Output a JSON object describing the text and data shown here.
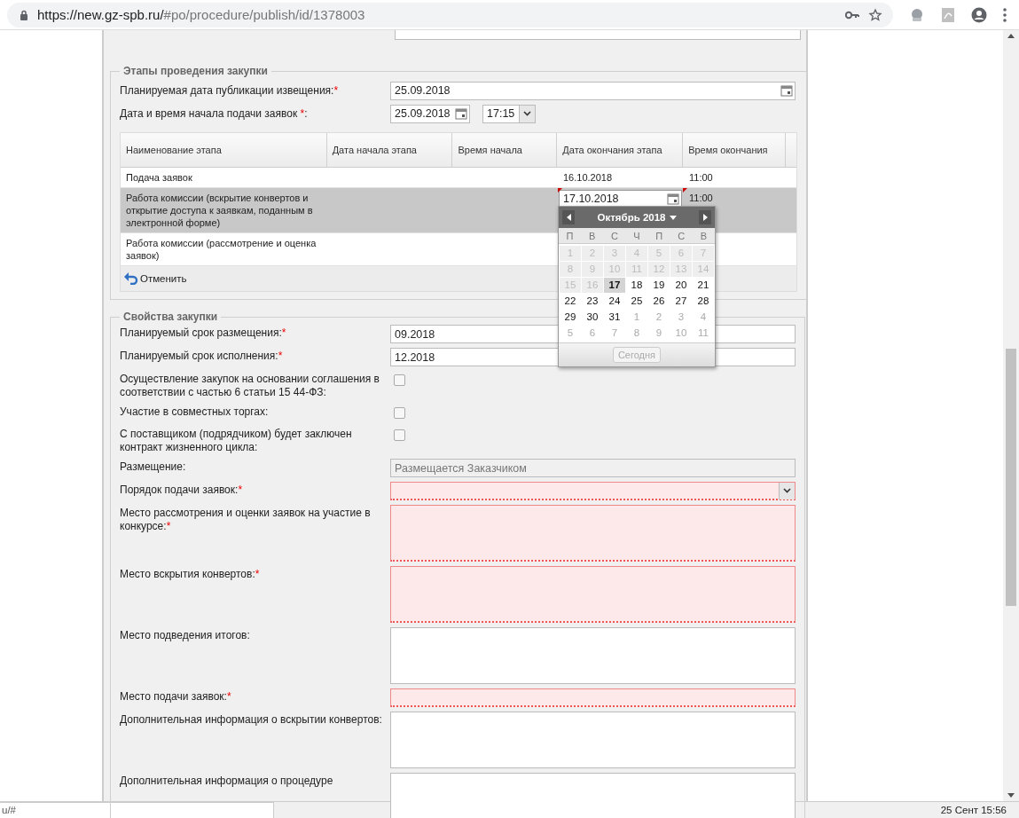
{
  "browser": {
    "url_host": "https://new.gz-spb.ru/",
    "url_path": "#po/procedure/publish/id/1378003"
  },
  "stages": {
    "title": "Этапы проведения закупки",
    "fields": [
      {
        "kind": "date",
        "label": "Планируемая дата публикации извещения:",
        "mark": "*",
        "value": "25.09.2018"
      },
      {
        "kind": "datetime",
        "label": "Дата и время начала подачи заявок ",
        "mark": "*",
        "suffix": ":",
        "value": "25.09.2018",
        "time": "17:15"
      }
    ],
    "columns": [
      {
        "label": "Наименование этапа"
      },
      {
        "label": "Дата начала этапа"
      },
      {
        "label": "Время начала"
      },
      {
        "label": "Дата окончания этапа"
      },
      {
        "label": "Время окончания"
      }
    ],
    "rows": [
      {
        "name": "Подача заявок",
        "end_date": "16.10.2018",
        "end_time": "11:00",
        "selected": false,
        "editing": false
      },
      {
        "name": "Работа комиссии (вскрытие конвертов и открытие доступа к заявкам, поданным в электронной форме)",
        "end_date": "17.10.2018",
        "end_time": "11:00",
        "selected": true,
        "editing": true
      },
      {
        "name": "Работа комиссии (рассмотрение и оценка заявок)",
        "selected": false,
        "editing": false
      }
    ],
    "cancel": "Отменить",
    "calendar": {
      "month": "Октябрь 2018",
      "weekdays": [
        "П",
        "В",
        "С",
        "Ч",
        "П",
        "С",
        "В"
      ],
      "today": "Сегодня",
      "days": [
        {
          "d": "1",
          "kind": "disabled",
          "selected": false
        },
        {
          "d": "2",
          "kind": "disabled",
          "selected": false
        },
        {
          "d": "3",
          "kind": "disabled",
          "selected": false
        },
        {
          "d": "4",
          "kind": "disabled",
          "selected": false
        },
        {
          "d": "5",
          "kind": "disabled",
          "selected": false
        },
        {
          "d": "6",
          "kind": "disabled",
          "selected": false
        },
        {
          "d": "7",
          "kind": "disabled",
          "selected": false
        },
        {
          "d": "8",
          "kind": "disabled",
          "selected": false
        },
        {
          "d": "9",
          "kind": "disabled",
          "selected": false
        },
        {
          "d": "10",
          "kind": "disabled",
          "selected": false
        },
        {
          "d": "11",
          "kind": "disabled",
          "selected": false
        },
        {
          "d": "12",
          "kind": "disabled",
          "selected": false
        },
        {
          "d": "13",
          "kind": "disabled",
          "selected": false
        },
        {
          "d": "14",
          "kind": "disabled",
          "selected": false
        },
        {
          "d": "15",
          "kind": "disabled",
          "selected": false
        },
        {
          "d": "16",
          "kind": "disabled",
          "selected": false
        },
        {
          "d": "17",
          "kind": "current",
          "selected": true
        },
        {
          "d": "18",
          "kind": "current",
          "selected": false
        },
        {
          "d": "19",
          "kind": "current",
          "selected": false
        },
        {
          "d": "20",
          "kind": "current",
          "selected": false
        },
        {
          "d": "21",
          "kind": "current",
          "selected": false
        },
        {
          "d": "22",
          "kind": "current",
          "selected": false
        },
        {
          "d": "23",
          "kind": "current",
          "selected": false
        },
        {
          "d": "24",
          "kind": "current",
          "selected": false
        },
        {
          "d": "25",
          "kind": "current",
          "selected": false
        },
        {
          "d": "26",
          "kind": "current",
          "selected": false
        },
        {
          "d": "27",
          "kind": "current",
          "selected": false
        },
        {
          "d": "28",
          "kind": "current",
          "selected": false
        },
        {
          "d": "29",
          "kind": "current",
          "selected": false
        },
        {
          "d": "30",
          "kind": "current",
          "selected": false
        },
        {
          "d": "31",
          "kind": "current",
          "selected": false
        },
        {
          "d": "1",
          "kind": "other",
          "selected": false
        },
        {
          "d": "2",
          "kind": "other",
          "selected": false
        },
        {
          "d": "3",
          "kind": "other",
          "selected": false
        },
        {
          "d": "4",
          "kind": "other",
          "selected": false
        },
        {
          "d": "5",
          "kind": "other",
          "selected": false
        },
        {
          "d": "6",
          "kind": "other",
          "selected": false
        },
        {
          "d": "7",
          "kind": "other",
          "selected": false
        },
        {
          "d": "8",
          "kind": "other",
          "selected": false
        },
        {
          "d": "9",
          "kind": "other",
          "selected": false
        },
        {
          "d": "10",
          "kind": "other",
          "selected": false
        },
        {
          "d": "11",
          "kind": "other",
          "selected": false
        }
      ]
    }
  },
  "props": {
    "title": "Свойства закупки",
    "rows": [
      {
        "kind": "text",
        "label": "Планируемый срок размещения:",
        "mark": "*",
        "value": "09.2018",
        "invalid": false,
        "disabled": false
      },
      {
        "kind": "text",
        "label": "Планируемый срок исполнения:",
        "mark": "*",
        "value": "12.2018",
        "invalid": false,
        "disabled": false
      },
      {
        "kind": "checkbox",
        "label": "Осуществление закупок на основании соглашения в соответствии с частью 6 статьи 15 44-ФЗ:",
        "checked": false
      },
      {
        "kind": "checkbox",
        "label": "Участие в совместных торгах:",
        "checked": false
      },
      {
        "kind": "checkbox",
        "label": "С поставщиком (подрядчиком) будет заключен контракт жизненного цикла:",
        "checked": false
      },
      {
        "kind": "text",
        "label": "Размещение:",
        "value": "Размещается Заказчиком",
        "invalid": false,
        "disabled": true
      },
      {
        "kind": "select",
        "label": "Порядок подачи заявок:",
        "mark": "*",
        "invalid": true
      },
      {
        "kind": "textarea",
        "label": "Место рассмотрения и оценки заявок на участие в конкурсе:",
        "mark": "*",
        "invalid": true
      },
      {
        "kind": "textarea",
        "label": "Место вскрытия конвертов:",
        "mark": "*",
        "invalid": true
      },
      {
        "kind": "textarea",
        "label": "Место подведения итогов:",
        "invalid": false
      },
      {
        "kind": "text",
        "label": "Место подачи заявок:",
        "mark": "*",
        "invalid": true,
        "disabled": false
      },
      {
        "kind": "textarea",
        "label": "Дополнительная информация о вскрытии конвертов:",
        "invalid": false
      },
      {
        "kind": "textarea",
        "label": "Дополнительная информация о процедуре",
        "invalid": false
      }
    ]
  },
  "status": {
    "link": "u/#",
    "clock": "25 Сент 15:56"
  }
}
